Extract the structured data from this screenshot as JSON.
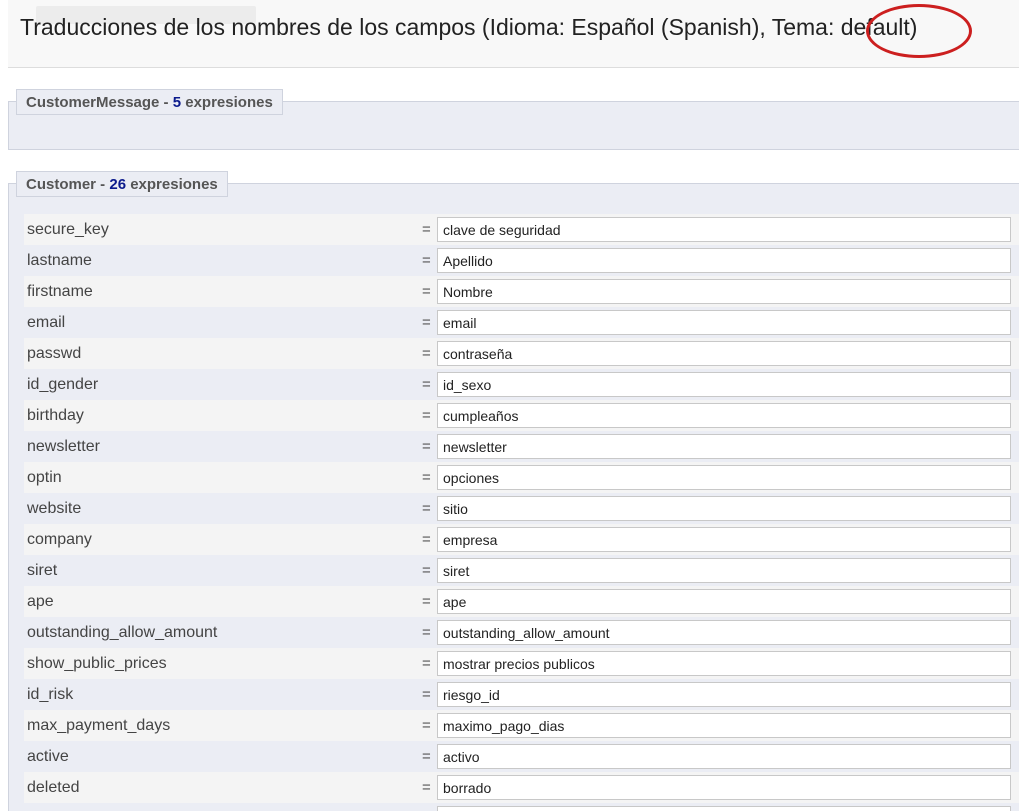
{
  "header": {
    "title": "Traducciones de los nombres de los campos (Idioma: Español (Spanish), Tema: default)"
  },
  "sections": [
    {
      "name": "CustomerMessage",
      "separator": " - ",
      "count": "5",
      "suffix": " expresiones"
    },
    {
      "name": "Customer",
      "separator": " - ",
      "count": "26",
      "suffix": " expresiones"
    }
  ],
  "equals": "=",
  "rows": [
    {
      "key": "secure_key",
      "value": "clave de seguridad"
    },
    {
      "key": "lastname",
      "value": "Apellido"
    },
    {
      "key": "firstname",
      "value": "Nombre"
    },
    {
      "key": "email",
      "value": "email"
    },
    {
      "key": "passwd",
      "value": "contraseña"
    },
    {
      "key": "id_gender",
      "value": "id_sexo"
    },
    {
      "key": "birthday",
      "value": "cumpleaños"
    },
    {
      "key": "newsletter",
      "value": "newsletter"
    },
    {
      "key": "optin",
      "value": "opciones"
    },
    {
      "key": "website",
      "value": "sitio"
    },
    {
      "key": "company",
      "value": "empresa"
    },
    {
      "key": "siret",
      "value": "siret"
    },
    {
      "key": "ape",
      "value": "ape"
    },
    {
      "key": "outstanding_allow_amount",
      "value": "outstanding_allow_amount"
    },
    {
      "key": "show_public_prices",
      "value": "mostrar precios publicos"
    },
    {
      "key": "id_risk",
      "value": "riesgo_id"
    },
    {
      "key": "max_payment_days",
      "value": "maximo_pago_dias"
    },
    {
      "key": "active",
      "value": "activo"
    },
    {
      "key": "deleted",
      "value": "borrado"
    },
    {
      "key": "",
      "value": ""
    }
  ],
  "colors": {
    "annotation": "#cc1f1f",
    "count": "#0b1a8c",
    "panel": "#ebedf4"
  }
}
